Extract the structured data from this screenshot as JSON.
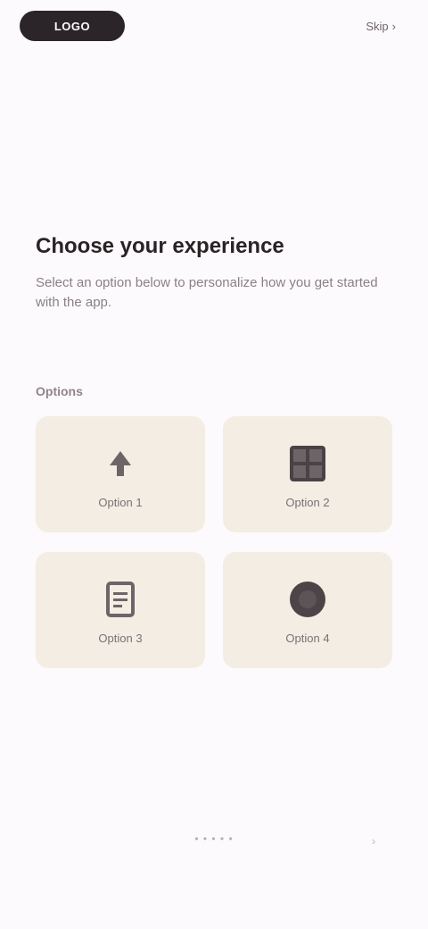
{
  "header": {
    "brand": "LOGO",
    "action_label": "Skip"
  },
  "main": {
    "title": "Choose your experience",
    "description": "Select an option below to personalize how you get started with the app.",
    "section_label": "Options",
    "options": [
      {
        "label": "Option 1",
        "icon": "arrow-up-icon"
      },
      {
        "label": "Option 2",
        "icon": "grid-icon"
      },
      {
        "label": "Option 3",
        "icon": "document-icon"
      },
      {
        "label": "Option 4",
        "icon": "circle-icon"
      }
    ]
  },
  "footer": {
    "text": "• • • • •",
    "icon": "chevron-right-icon"
  },
  "colors": {
    "background": "#fdfafd",
    "card": "#f3ede3",
    "ink": "#2a2326"
  }
}
